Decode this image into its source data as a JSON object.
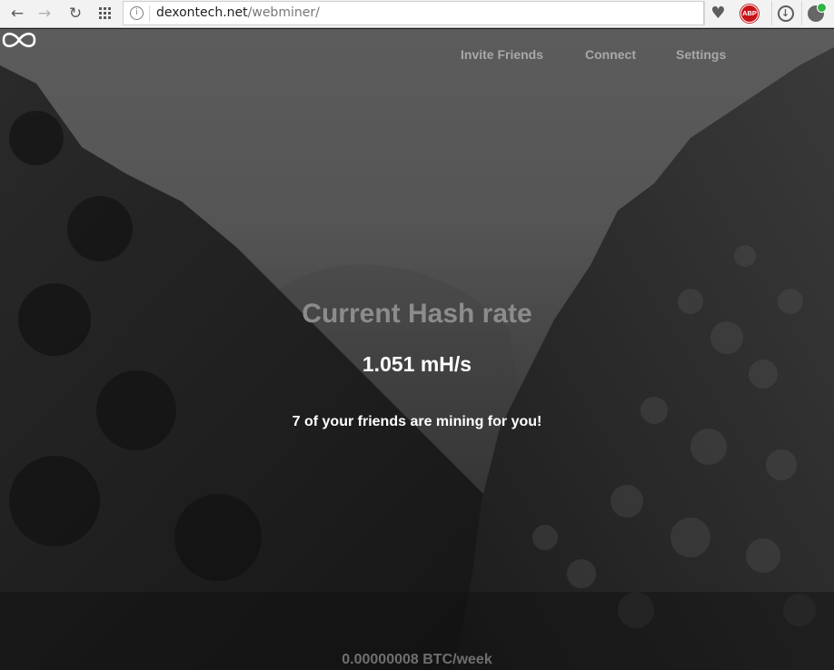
{
  "browser": {
    "url_domain": "dexontech.net",
    "url_path": "/webminer/",
    "icons": {
      "back": "back-arrow-icon",
      "forward": "forward-arrow-icon",
      "reload": "reload-icon",
      "apps": "apps-grid-icon",
      "site_info": "site-info-icon",
      "bookmark": "heart-icon",
      "adblock": "adblock-plus-icon",
      "download": "download-icon",
      "extension": "extension-icon"
    },
    "adblock_label": "ABP"
  },
  "site": {
    "logo": "infinity-icon",
    "nav": [
      "Invite Friends",
      "Connect",
      "Settings"
    ]
  },
  "main": {
    "headline": "Current Hash rate",
    "hash_rate": "1.051 mH/s",
    "friends_text": "7 of your friends are mining for you!",
    "earnings": "0.00000008 BTC/week"
  },
  "colors": {
    "nav_text": "#a8a8a8",
    "headline": "#8c8c8c",
    "value_text": "#ffffff",
    "adblock_red": "#c7141a"
  }
}
